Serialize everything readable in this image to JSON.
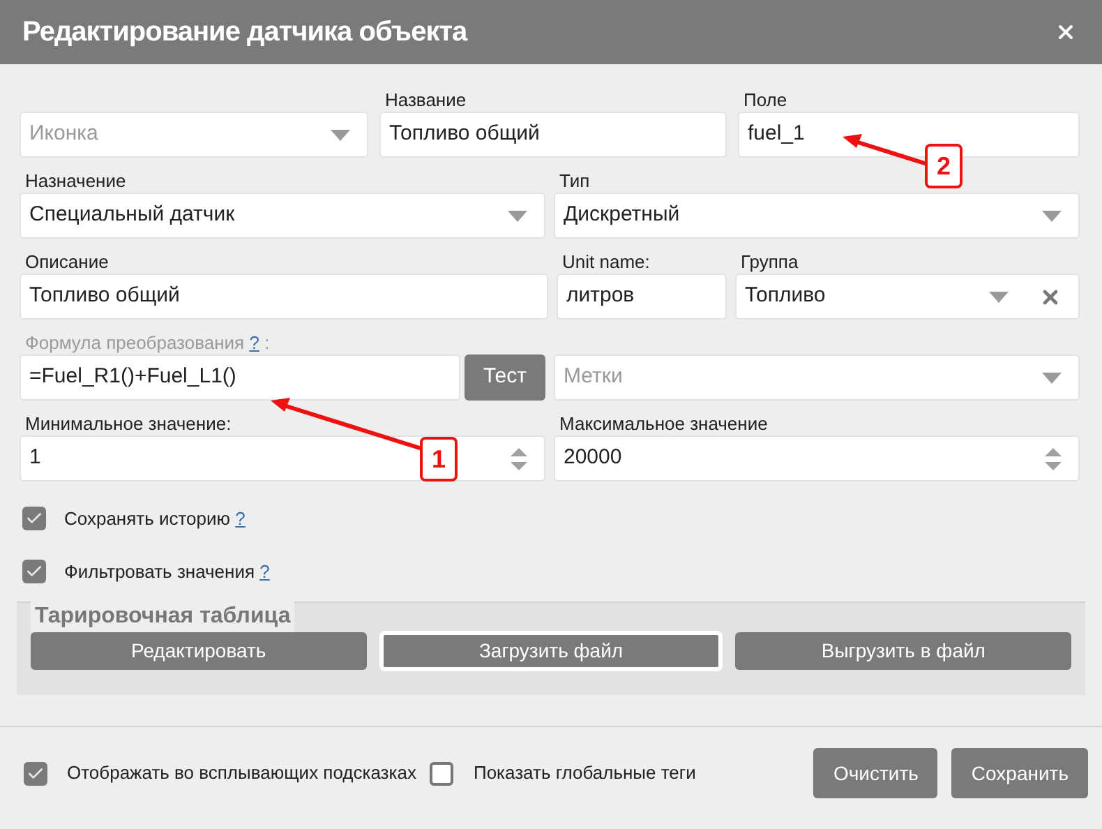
{
  "window": {
    "title": "Редактирование датчика объекта"
  },
  "rows": [
    [
      {
        "kind": "select",
        "placeholder": "Иконка"
      },
      {
        "kind": "text",
        "label": "Название",
        "value": "Топливо общий"
      },
      {
        "kind": "text",
        "label": "Поле",
        "value": "fuel_1"
      }
    ],
    [
      {
        "kind": "select",
        "label": "Назначение",
        "value": "Специальный датчик"
      },
      {
        "kind": "select",
        "label": "Тип",
        "value": "Дискретный"
      }
    ],
    [
      {
        "kind": "text",
        "label": "Описание",
        "value": "Топливо общий"
      },
      {
        "kind": "text",
        "label": "Unit name:",
        "value": "литров"
      },
      {
        "kind": "select",
        "label": "Группа",
        "value": "Топливо",
        "clearable": true
      }
    ],
    [
      {
        "kind": "formula",
        "label": "Формула преобразования",
        "help": "?",
        "suffix": ":",
        "value": "=Fuel_R1()+Fuel_L1()",
        "button": "Тест"
      },
      {
        "kind": "select",
        "placeholder": "Метки"
      }
    ],
    [
      {
        "kind": "number",
        "label": "Минимальное значение:",
        "value": "1"
      },
      {
        "kind": "number",
        "label": "Максимальное значение",
        "value": "20000"
      }
    ]
  ],
  "options": [
    {
      "label": "Сохранять историю",
      "help": "?",
      "checked": true
    },
    {
      "label": "Фильтровать значения",
      "help": "?",
      "checked": true
    }
  ],
  "calibration": {
    "legend": "Тарировочная таблица",
    "buttons": [
      {
        "label": "Редактировать",
        "selected": false
      },
      {
        "label": "Загрузить файл",
        "selected": true
      },
      {
        "label": "Выгрузить в файл",
        "selected": false
      }
    ]
  },
  "footer": {
    "checkboxes": [
      {
        "label": "Отображать во всплывающих подсказках",
        "checked": true
      },
      {
        "label": "Показать глобальные теги",
        "checked": false
      }
    ],
    "buttons": [
      "Очистить",
      "Сохранить"
    ]
  },
  "callouts": [
    {
      "label": "1"
    },
    {
      "label": "2"
    }
  ]
}
